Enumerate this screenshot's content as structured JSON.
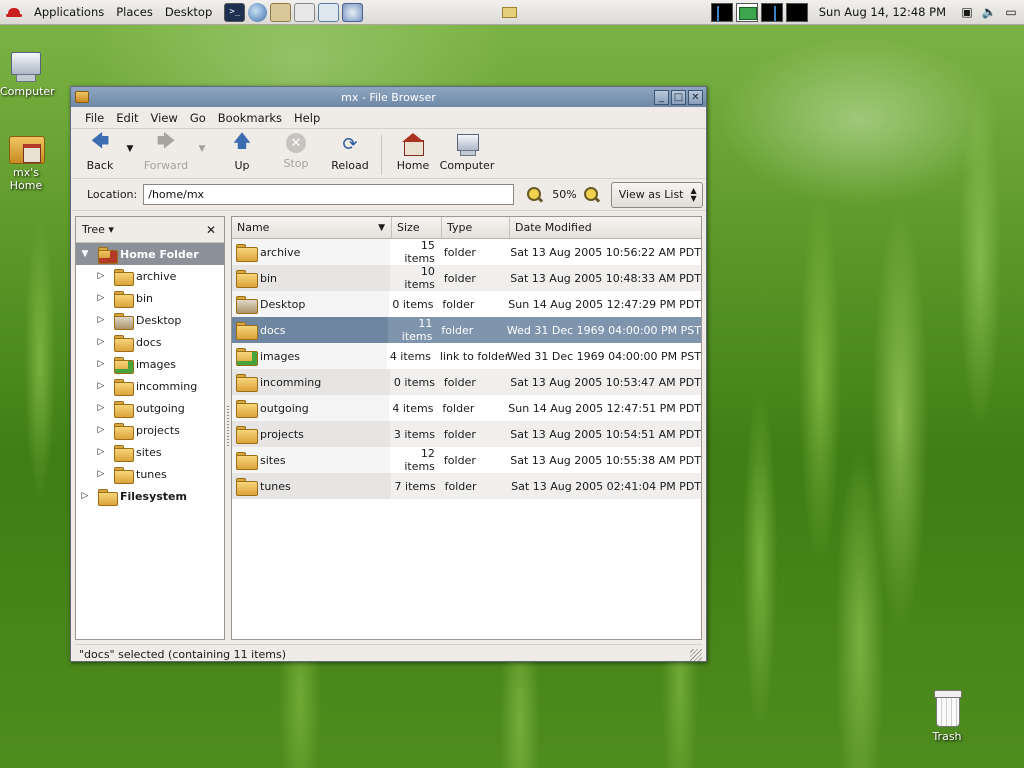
{
  "panel": {
    "menus": [
      "Applications",
      "Places",
      "Desktop"
    ],
    "launchers": [
      "terminal-icon",
      "web-browser-icon",
      "mail-icon",
      "writer-icon",
      "calc-icon",
      "draw-icon"
    ],
    "clock": "Sun Aug 14, 12:48 PM"
  },
  "desktop": {
    "computer_label": "Computer",
    "home_label": "mx's Home",
    "trash_label": "Trash"
  },
  "window": {
    "title": "mx - File Browser",
    "menus": [
      "File",
      "Edit",
      "View",
      "Go",
      "Bookmarks",
      "Help"
    ],
    "toolbar": {
      "back": "Back",
      "forward": "Forward",
      "up": "Up",
      "stop": "Stop",
      "reload": "Reload",
      "home": "Home",
      "computer": "Computer"
    },
    "location_label": "Location:",
    "location_value": "/home/mx",
    "zoom": "50%",
    "view_as": "View as List",
    "side_mode": "Tree",
    "tree": {
      "root": "Home Folder",
      "children": [
        "archive",
        "bin",
        "Desktop",
        "docs",
        "images",
        "incomming",
        "outgoing",
        "projects",
        "sites",
        "tunes"
      ],
      "filesystem": "Filesystem"
    },
    "columns": {
      "name": "Name",
      "size": "Size",
      "type": "Type",
      "date": "Date Modified"
    },
    "files": [
      {
        "name": "archive",
        "size": "15 items",
        "type": "folder",
        "date": "Sat 13 Aug 2005 10:56:22 AM PDT"
      },
      {
        "name": "bin",
        "size": "10 items",
        "type": "folder",
        "date": "Sat 13 Aug 2005 10:48:33 AM PDT"
      },
      {
        "name": "Desktop",
        "size": "0 items",
        "type": "folder",
        "date": "Sun 14 Aug 2005 12:47:29 PM PDT"
      },
      {
        "name": "docs",
        "size": "11 items",
        "type": "folder",
        "date": "Wed 31 Dec 1969 04:00:00 PM PST"
      },
      {
        "name": "images",
        "size": "4 items",
        "type": "link to folder",
        "date": "Wed 31 Dec 1969 04:00:00 PM PST"
      },
      {
        "name": "incomming",
        "size": "0 items",
        "type": "folder",
        "date": "Sat 13 Aug 2005 10:53:47 AM PDT"
      },
      {
        "name": "outgoing",
        "size": "4 items",
        "type": "folder",
        "date": "Sun 14 Aug 2005 12:47:51 PM PDT"
      },
      {
        "name": "projects",
        "size": "3 items",
        "type": "folder",
        "date": "Sat 13 Aug 2005 10:54:51 AM PDT"
      },
      {
        "name": "sites",
        "size": "12 items",
        "type": "folder",
        "date": "Sat 13 Aug 2005 10:55:38 AM PDT"
      },
      {
        "name": "tunes",
        "size": "7 items",
        "type": "folder",
        "date": "Sat 13 Aug 2005 02:41:04 PM PDT"
      }
    ],
    "status": "\"docs\" selected (containing 11 items)"
  }
}
